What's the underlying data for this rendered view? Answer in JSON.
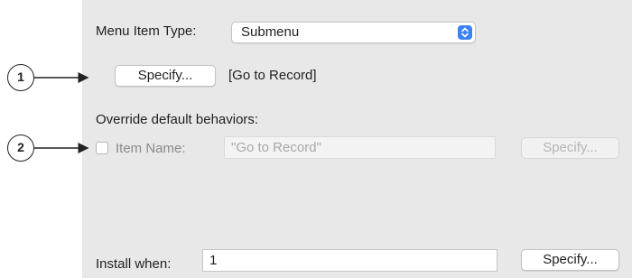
{
  "menu_item_type": {
    "label": "Menu Item Type:",
    "value": "Submenu",
    "icon": "updown-arrows-icon"
  },
  "target": {
    "specify_label": "Specify...",
    "value": "[Go to Record]"
  },
  "override": {
    "heading": "Override default behaviors:",
    "item_name_label": "Item Name:",
    "item_name_checked": false,
    "item_name_value": "\"Go to Record\"",
    "specify_label": "Specify..."
  },
  "install_when": {
    "label": "Install when:",
    "value": "1",
    "specify_label": "Specify..."
  },
  "callouts": [
    "1",
    "2"
  ],
  "colors": {
    "panel_bg": "#e8e8e8",
    "popup_accent": "#3b82f6"
  }
}
